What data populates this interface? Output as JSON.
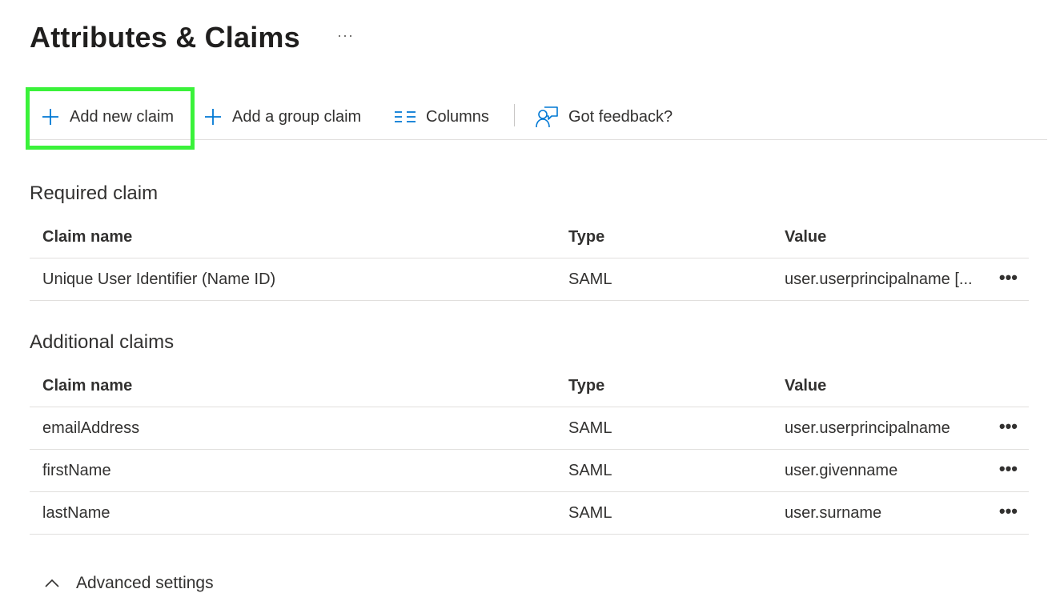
{
  "page": {
    "title": "Attributes & Claims",
    "title_more": "···"
  },
  "toolbar": {
    "add_new_claim": "Add new claim",
    "add_group_claim": "Add a group claim",
    "columns": "Columns",
    "feedback": "Got feedback?",
    "icons": {
      "add": "plus-icon",
      "columns": "columns-icon",
      "feedback": "feedback-icon"
    },
    "accent_color": "#0078d4",
    "highlight_color": "#3af23a"
  },
  "required": {
    "title": "Required claim",
    "columns": [
      "Claim name",
      "Type",
      "Value"
    ],
    "rows": [
      {
        "name": "Unique User Identifier (Name ID)",
        "type": "SAML",
        "value": "user.userprincipalname [...",
        "more": "•••"
      }
    ]
  },
  "additional": {
    "title": "Additional claims",
    "columns": [
      "Claim name",
      "Type",
      "Value"
    ],
    "rows": [
      {
        "name": "emailAddress",
        "type": "SAML",
        "value": "user.userprincipalname",
        "more": "•••"
      },
      {
        "name": "firstName",
        "type": "SAML",
        "value": "user.givenname",
        "more": "•••"
      },
      {
        "name": "lastName",
        "type": "SAML",
        "value": "user.surname",
        "more": "•••"
      }
    ]
  },
  "advanced": {
    "label": "Advanced settings",
    "icon": "chevron-up-icon"
  }
}
